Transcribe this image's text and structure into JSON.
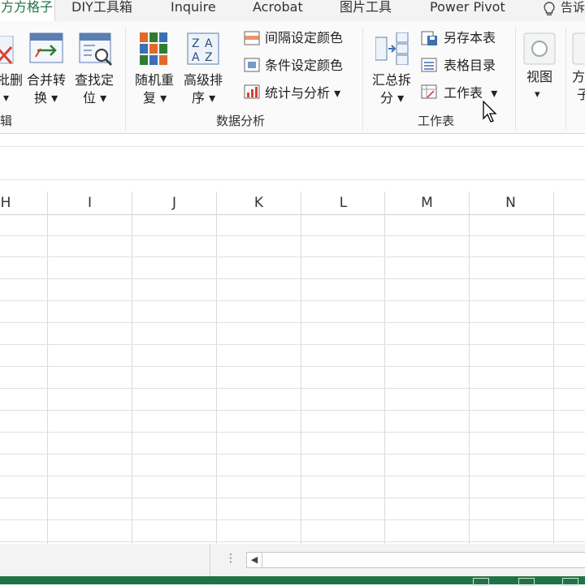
{
  "tabs": [
    {
      "label": "方方格子",
      "active": true
    },
    {
      "label": "DIY工具箱"
    },
    {
      "label": "Inquire"
    },
    {
      "label": "Acrobat"
    },
    {
      "label": "图片工具"
    },
    {
      "label": "Power Pivot"
    },
    {
      "label": "告诉"
    }
  ],
  "ribbon": {
    "edit_group": {
      "delete_label_line1": "批删",
      "merge_label_line1": "合并转",
      "merge_label_line2": "换",
      "find_label_line1": "查找定",
      "find_label_line2": "位",
      "group_label": "辑"
    },
    "data_analysis": {
      "random_line1": "随机重",
      "random_line2": "复",
      "sort_line1": "高级排",
      "sort_line2": "序",
      "interval_color": "间隔设定颜色",
      "condition_color": "条件设定颜色",
      "stats": "统计与分析",
      "group_label": "数据分析"
    },
    "worksheet": {
      "summary_line1": "汇总拆",
      "summary_line2": "分",
      "save_as": "另存本表",
      "toc": "表格目录",
      "worksheet": "工作表",
      "group_label": "工作表"
    },
    "view": {
      "view_label": "视图",
      "partial1": "方",
      "partial2": "子"
    }
  },
  "columns": [
    "H",
    "I",
    "J",
    "K",
    "L",
    "M",
    "N"
  ],
  "colors": {
    "accent": "#217346",
    "status": "#217346"
  }
}
